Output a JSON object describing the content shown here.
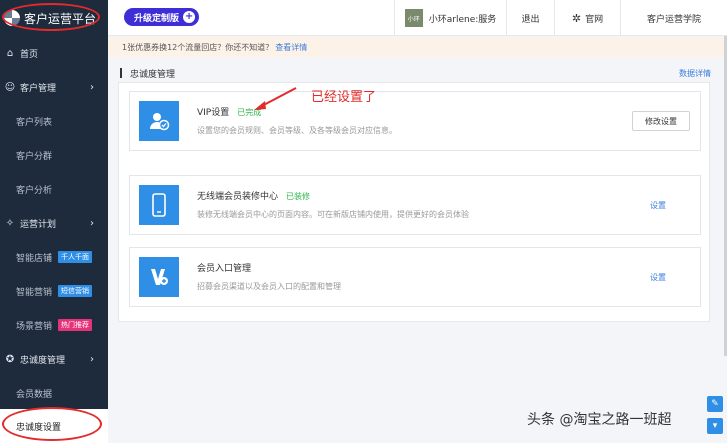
{
  "sidebar": {
    "brand": "客户运营平台",
    "items": [
      {
        "label": "首页",
        "icon": "home-icon",
        "type": "group"
      },
      {
        "label": "客户管理",
        "icon": "users-icon",
        "type": "group",
        "chevron": "›"
      },
      {
        "label": "客户列表",
        "type": "sub"
      },
      {
        "label": "客户分群",
        "type": "sub"
      },
      {
        "label": "客户分析",
        "type": "sub"
      },
      {
        "label": "运营计划",
        "icon": "bulb-icon",
        "type": "group",
        "chevron": "›"
      },
      {
        "label": "智能店铺",
        "type": "sub",
        "badge": "千人千面",
        "badge_color": "#2f8ee5"
      },
      {
        "label": "智能营销",
        "type": "sub",
        "badge": "短信营销",
        "badge_color": "#2f8ee5"
      },
      {
        "label": "场景营销",
        "type": "sub",
        "badge": "热门推荐",
        "badge_color": "#e5337a"
      },
      {
        "label": "忠诚度管理",
        "icon": "loyalty-icon",
        "type": "group",
        "chevron": "›"
      },
      {
        "label": "会员数据",
        "type": "sub"
      },
      {
        "label": "忠诚度设置",
        "type": "sub",
        "active": true
      }
    ]
  },
  "topbar": {
    "upgrade_label": "升级定制版",
    "user_name": "小环arlene:服务",
    "avatar_text": "小环",
    "logout": "退出",
    "website": "官网",
    "academy": "客户运营学院"
  },
  "notice": {
    "text": "1张优惠券换12个流量回店？你还不知道？",
    "link": "查看详情"
  },
  "section": {
    "title": "忠诚度管理",
    "detail_link": "数据详情"
  },
  "annotation": "已经设置了",
  "cards": [
    {
      "title": "VIP设置",
      "status": "已完成",
      "desc": "设置您的会员规则、会员等级、及各等级会员对应信息。",
      "action": "修改设置",
      "action_type": "button",
      "icon": "vip-user-icon"
    },
    {
      "title": "无线端会员装修中心",
      "status": "已装修",
      "desc": "装修无线端会员中心的页面内容。可在新版店铺内使用，提供更好的会员体验",
      "action": "设置",
      "action_type": "link",
      "icon": "mobile-icon"
    },
    {
      "title": "会员入口管理",
      "status": "",
      "desc": "招募会员渠道以及会员入口的配置和管理",
      "action": "设置",
      "action_type": "link",
      "icon": "entry-icon"
    }
  ],
  "watermark": "头条 @淘宝之路一班超",
  "colors": {
    "sidebar_bg": "#1d2b3d",
    "accent": "#2f8ee5",
    "annotation": "#e32b2b",
    "status_done": "#2db84d",
    "upgrade": "#3d2ed8"
  }
}
